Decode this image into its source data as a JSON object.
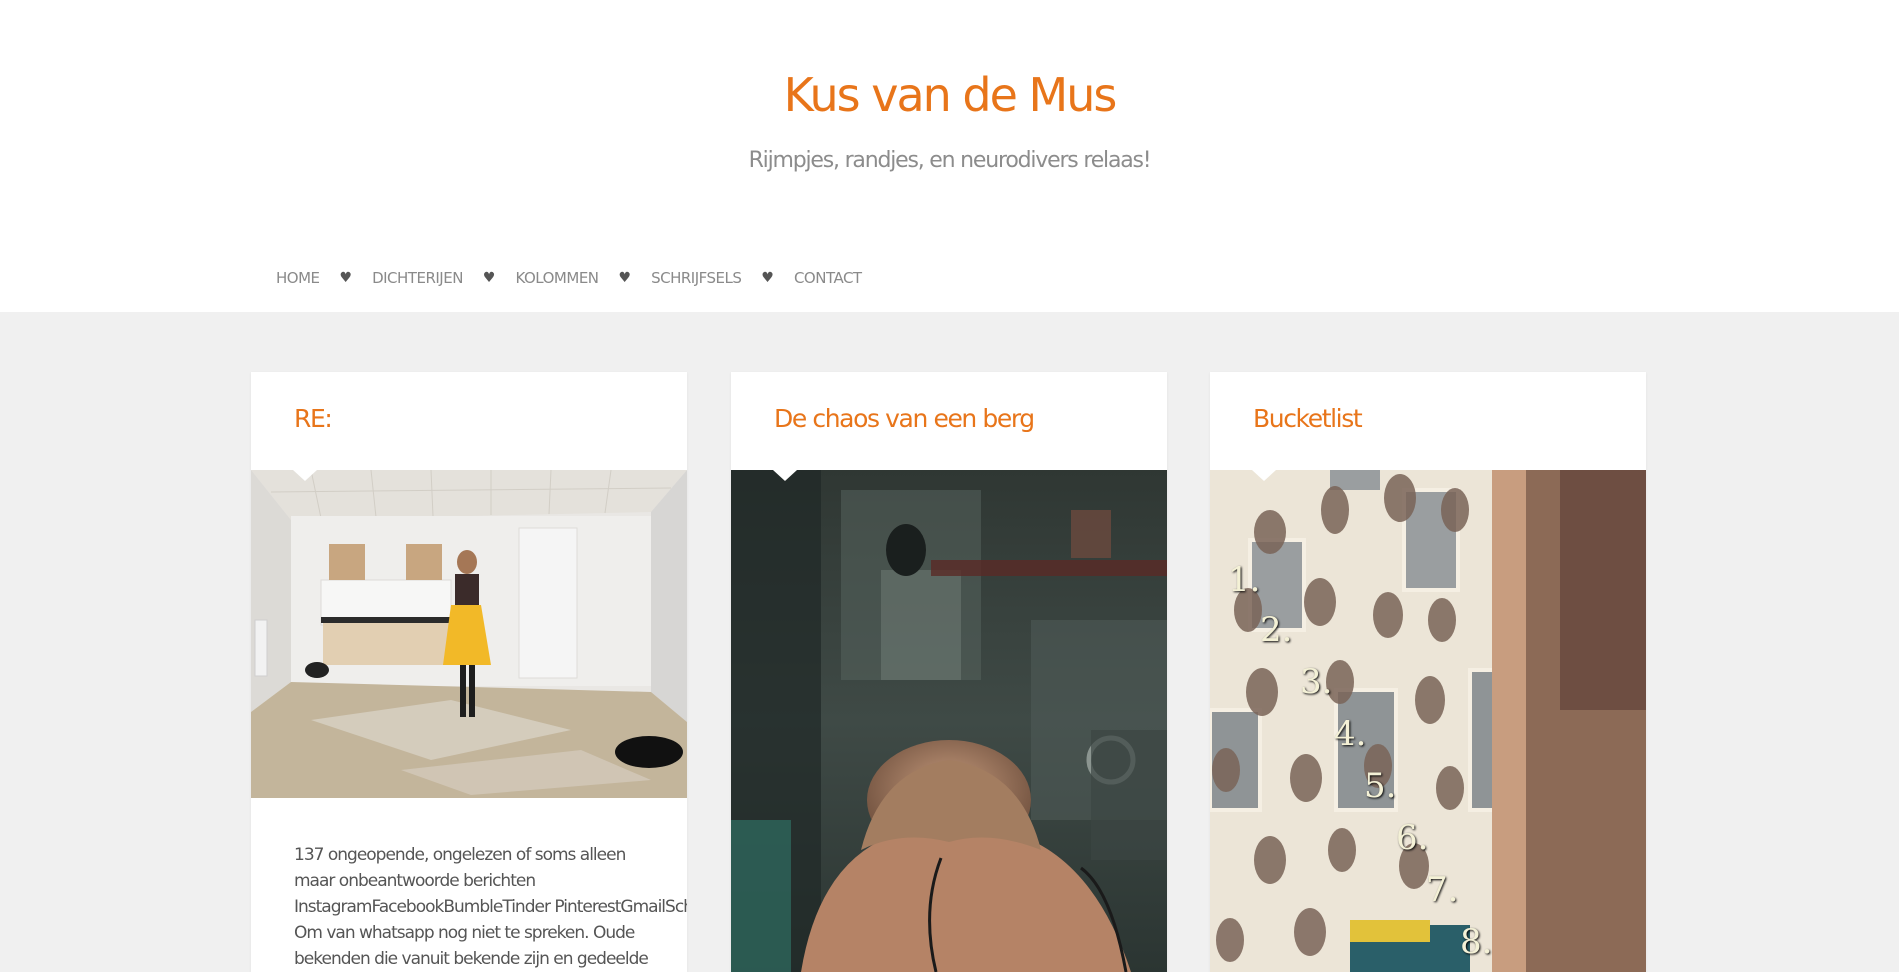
{
  "site": {
    "title": "Kus van de Mus",
    "tagline": "Rijmpjes, randjes, en neurodivers relaas!"
  },
  "nav": {
    "items": [
      "HOME",
      "DICHTERIJEN",
      "KOLOMMEN",
      "SCHRIJFSELS",
      "CONTACT"
    ],
    "separator": "♥"
  },
  "posts": [
    {
      "title": "RE:",
      "excerpt": [
        "137 ongeopende, ongelezen of soms alleen",
        "maar onbeantwoorde berichten",
        "InstagramFacebookBumbleTinder PinterestGmailSchool",
        "Om van whatsapp nog niet te spreken. Oude",
        "bekenden die vanuit bekende zijn en gedeelde"
      ]
    },
    {
      "title": "De chaos van een berg"
    },
    {
      "title": "Bucketlist",
      "image_list_numbers": [
        "1.",
        "2.",
        "3.",
        "4.",
        "5.",
        "6.",
        "7.",
        "8."
      ]
    }
  ],
  "colors": {
    "accent": "#e8751a",
    "tagline": "#8c8c8c",
    "nav": "#8a8a8a",
    "page_background": "#f0f0f0"
  }
}
